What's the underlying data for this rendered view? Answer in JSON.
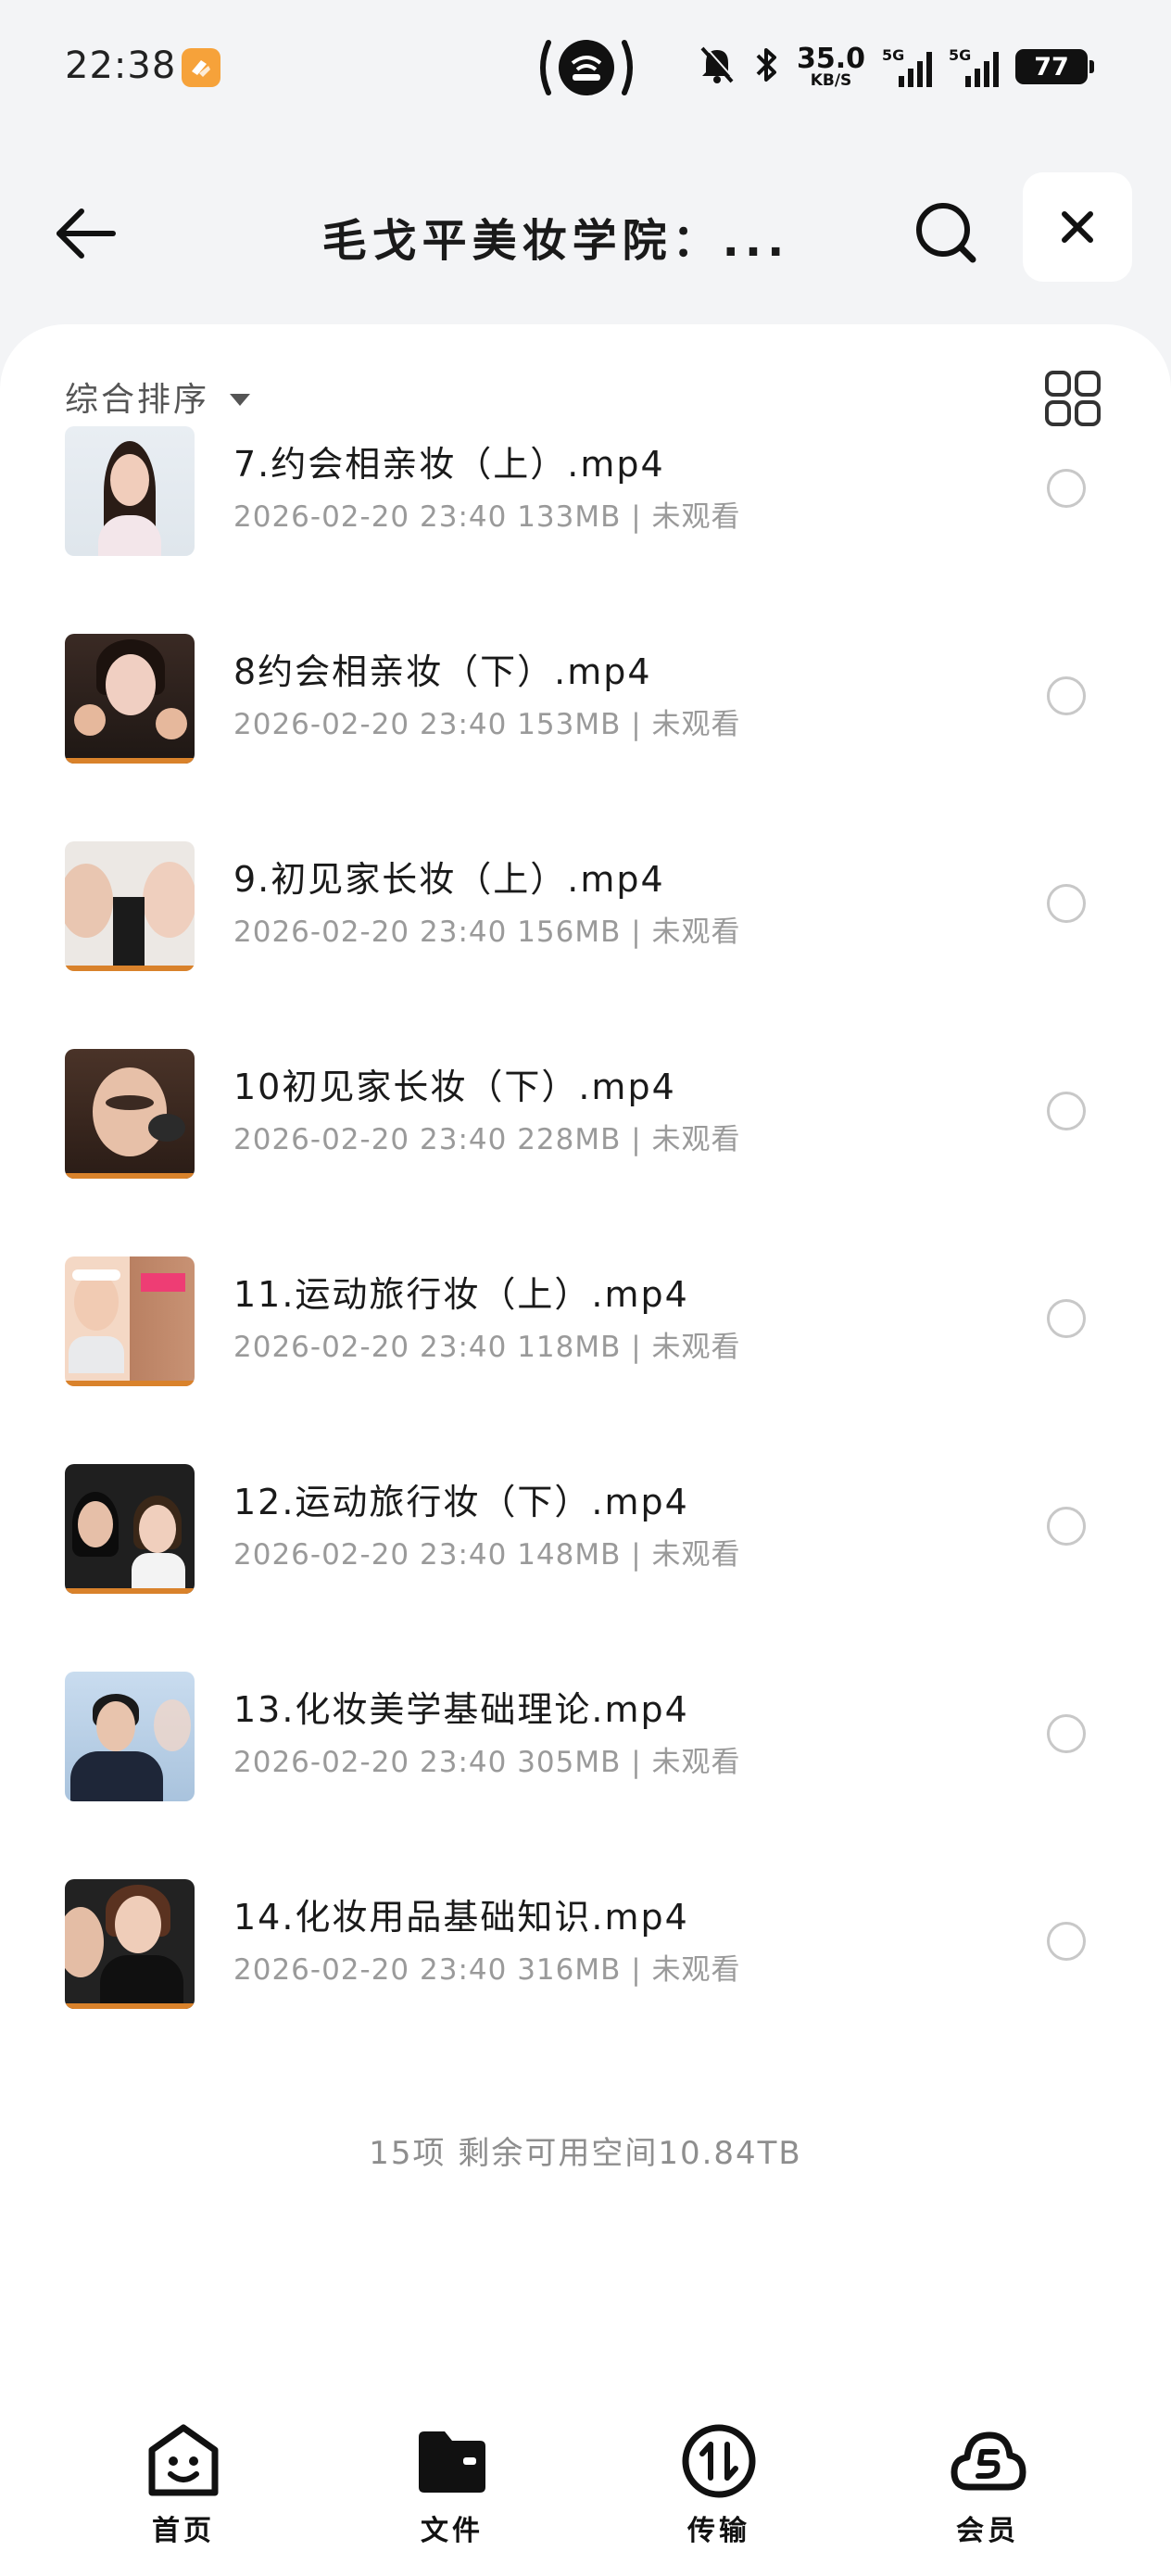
{
  "status_bar": {
    "time": "22:38",
    "net_speed_value": "35.0",
    "net_speed_unit": "KB/S",
    "sim1_label": "5G",
    "sim2_label": "5G",
    "battery": "77"
  },
  "header": {
    "title": "毛戈平美妆学院：...",
    "back_icon": "arrow-left-icon",
    "search_icon": "search-icon",
    "close_icon": "close-icon"
  },
  "sort": {
    "label": "综合排序",
    "view_icon": "grid-view-icon"
  },
  "files": [
    {
      "name": "7.约会相亲妆（上）.mp4",
      "meta": "2026-02-20 23:40  133MB | 未观看"
    },
    {
      "name": "8约会相亲妆（下）.mp4",
      "meta": "2026-02-20 23:40  153MB | 未观看"
    },
    {
      "name": "9.初见家长妆（上）.mp4",
      "meta": "2026-02-20 23:40  156MB | 未观看"
    },
    {
      "name": "10初见家长妆（下）.mp4",
      "meta": "2026-02-20 23:40  228MB | 未观看"
    },
    {
      "name": "11.运动旅行妆（上）.mp4",
      "meta": "2026-02-20 23:40  118MB | 未观看"
    },
    {
      "name": "12.运动旅行妆（下）.mp4",
      "meta": "2026-02-20 23:40  148MB | 未观看"
    },
    {
      "name": "13.化妆美学基础理论.mp4",
      "meta": "2026-02-20 23:40  305MB | 未观看"
    },
    {
      "name": "14.化妆用品基础知识.mp4",
      "meta": "2026-02-20 23:40  316MB | 未观看"
    }
  ],
  "summary": "15项 剩余可用空间10.84TB",
  "bottom_nav": [
    {
      "label": "首页",
      "icon": "home-face-icon"
    },
    {
      "label": "文件",
      "icon": "folder-icon"
    },
    {
      "label": "传输",
      "icon": "transfer-icon"
    },
    {
      "label": "会员",
      "icon": "vip-cloud-icon"
    }
  ],
  "colors": {
    "background": "#f3f4f6",
    "panel": "#ffffff",
    "text_primary": "#1a1a1a",
    "text_secondary": "#9a9a9a",
    "badge_orange": "#f6a23a"
  }
}
